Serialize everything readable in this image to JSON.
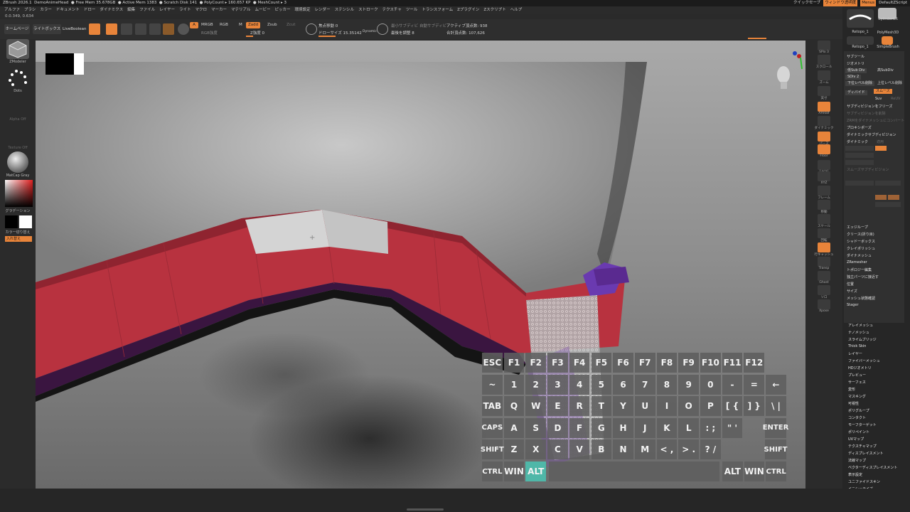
{
  "titlebar": {
    "app": "ZBrush 2026.1",
    "file": "DemoAnimeHead",
    "free_mem": "● Free Mem 35.678GB",
    "active_mem": "● Active Mem 1383",
    "scratch": "● Scratch Disk 141",
    "poly": "● PolyCount ▸ 160.657 KP",
    "mesh": "● MeshCount ▸ 3",
    "quicksave": "クイックセーブ",
    "window_trans": "ウィンドウ透明度",
    "menu_btn": "Menus",
    "script": "DefaultZScript"
  },
  "menus": [
    "アルファ",
    "ブラシ",
    "カラー",
    "ドキュメント",
    "ドロー",
    "ダイナミクス",
    "編集",
    "ファイル",
    "レイヤー",
    "ライト",
    "マクロ",
    "マーカー",
    "マテリアル",
    "ムービー",
    "ピッカー",
    "環境設定",
    "レンダー",
    "ステンシル",
    "ストローク",
    "テクスチャ",
    "ツール",
    "トランスフォーム",
    "Zプラグイン",
    "Zスクリプト",
    "ヘルプ"
  ],
  "coords": "0.0.349, 0.634",
  "toolbar": {
    "home": "ホームページ",
    "lightbox": "ライトボックス",
    "livebool": "LiveBoolean",
    "a_btn": "A",
    "mrgb": "MRGB",
    "rgb": "RGB",
    "m": "M",
    "zadd": "Zadd",
    "zsub": "Zsub",
    "zcut": "Zcut",
    "rgb_intensity": "RGB強度",
    "z_intensity": "Z強度 0",
    "focal": "焦点移動 0",
    "draw_size": "ドローサイズ 15.35142",
    "dynamic": "Dynamic",
    "subdiv_smooth": "最小サブディビ",
    "smooth_steps": "最後を調整 8",
    "collapse": "自動サブディビ",
    "active_points": "アクティブ頂点数: 938",
    "total_points": "合計頂点数: 107,626"
  },
  "leftshelf": {
    "zmodeler": "ZModeler",
    "dots": "Dots",
    "alpha_off": "Alpha Off",
    "texture_off": "Texture Off",
    "matcap": "MatCap Gray",
    "gradient": "グラデーション",
    "switch_color": "カラー切り替え",
    "alternate": "入れ替え"
  },
  "rightshelf": [
    "SPix 3",
    "スクロール",
    "ズーム",
    "実寸",
    "AAHalf",
    "ダイナミック",
    "パース",
    "Floor",
    "Local",
    "XYZ",
    "フレーム",
    "移動",
    "スケール",
    "回転",
    "行キャッシュ",
    "Transp",
    "Ghost",
    "ソロ",
    "Xpose"
  ],
  "brushes": {
    "b1": "Retopo_1",
    "b2": "CylinderCR",
    "b3": "PolyMesh3D",
    "b4": "Retopo_1",
    "b5": "SimpleBrush"
  },
  "panel_upper": {
    "subtool": "サブツール",
    "geometry": "ジオメトリ",
    "lower_res": "低Sub Div",
    "higher_res": "高SubDiv",
    "delete_lower": "下位レベル削除",
    "delete_higher": "上位レベル削除",
    "divide": "ディバイド",
    "smooth": "スムーズ",
    "suv": "Suv",
    "reuv": "ReUV",
    "freeze_sub": "サブディビジョンをフリーズ",
    "freeze_sub2": "サブディビジョンを削除",
    "convert": "ZRMをダイナメッシュにコンバート",
    "reconstruct": "プロキシポーズ",
    "dyn_sub": "ダイナミックサブディビジョン",
    "dynamic": "ダイナミック",
    "apply": "適用",
    "smooth_sub": "スムーズサブディビジョン",
    "edge_loop": "エッジループ",
    "crease": "クリース(折り目)",
    "shadowbox": "シャドーボックス",
    "clay_polish": "クレイポリッシュ",
    "dynamesh": "ダイナメッシュ",
    "zremesher": "ZRemesher",
    "topology": "トポロジー編集",
    "modify_topo": "独立パーツに接近す",
    "stager": "Stager",
    "position": "位置",
    "size": "サイズ",
    "mesh_integrity": "メッシュ状態確認"
  },
  "panel_lower": [
    "アレイメッシュ",
    "ナノメッシュ",
    "スライムブリッジ",
    "Thick Skin",
    "レイヤー",
    "ファイバーメッシュ",
    "HDジオメトリ",
    "プレビュー",
    "サーフェス",
    "変形",
    "マスキング",
    "可視性",
    "ポリグループ",
    "コンタクト",
    "モーフターゲット",
    "ポリペイント",
    "UVマップ",
    "テクスチャマップ",
    "ディスプレイスメント",
    "法線マップ",
    "ベクターディスプレイスメント",
    "表示設定",
    "ユニファイドスキン",
    "イニシャライズ",
    "インポート",
    "エクスポート"
  ],
  "keyboard": {
    "rows": [
      [
        "ESC",
        "F1",
        "F2",
        "F3",
        "F4",
        "F5",
        "F6",
        "F7",
        "F8",
        "F9",
        "F10",
        "F11",
        "F12"
      ],
      [
        "~",
        "1",
        "2",
        "3",
        "4",
        "5",
        "6",
        "7",
        "8",
        "9",
        "0",
        "-",
        "=",
        "←"
      ],
      [
        "TAB",
        "Q",
        "W",
        "E",
        "R",
        "T",
        "Y",
        "U",
        "I",
        "O",
        "P",
        "[ {",
        "] }",
        "\\ |"
      ],
      [
        "CAPS",
        "A",
        "S",
        "D",
        "F",
        "G",
        "H",
        "J",
        "K",
        "L",
        ": ;",
        "\" '",
        "ENTER"
      ],
      [
        "SHIFT",
        "Z",
        "X",
        "C",
        "V",
        "B",
        "N",
        "M",
        "< ,",
        "> .",
        "? /",
        "SHIFT"
      ],
      [
        "CTRL",
        "WIN",
        "ALT",
        "ALT",
        "WIN",
        "CTRL"
      ]
    ],
    "active_key": "ALT"
  },
  "colors": {
    "accent": "#e8843a",
    "key_active": "#4fb7a8",
    "mesh_red": "#b8323f",
    "mesh_purple": "#5a2a90"
  }
}
